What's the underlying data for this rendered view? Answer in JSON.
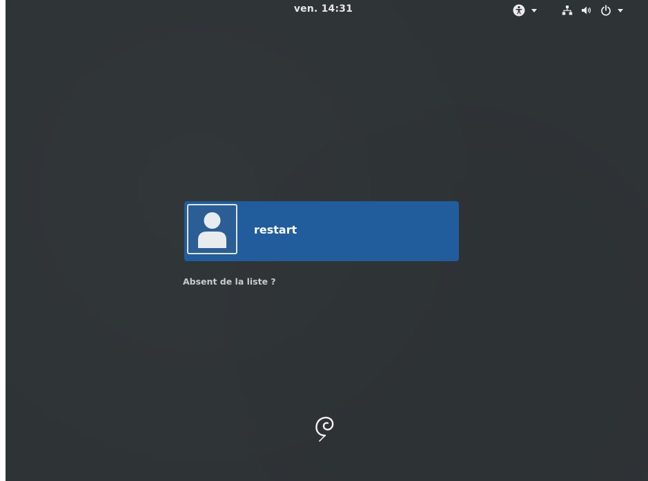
{
  "topbar": {
    "clock": "ven. 14:31",
    "icons": {
      "accessibility": "accessibility-icon",
      "network": "network-icon",
      "volume": "volume-icon",
      "power": "power-icon",
      "menu": "chevron-down-icon"
    }
  },
  "login": {
    "users": [
      {
        "name": "restart",
        "avatar": "user-avatar-icon"
      }
    ],
    "not_listed_label": "Absent de la liste ?"
  },
  "branding": {
    "logo": "debian-swirl-logo"
  },
  "colors": {
    "background": "#2e3336",
    "user_card": "#215d9c",
    "text": "#ffffff",
    "muted_text": "#c8cbcd"
  }
}
